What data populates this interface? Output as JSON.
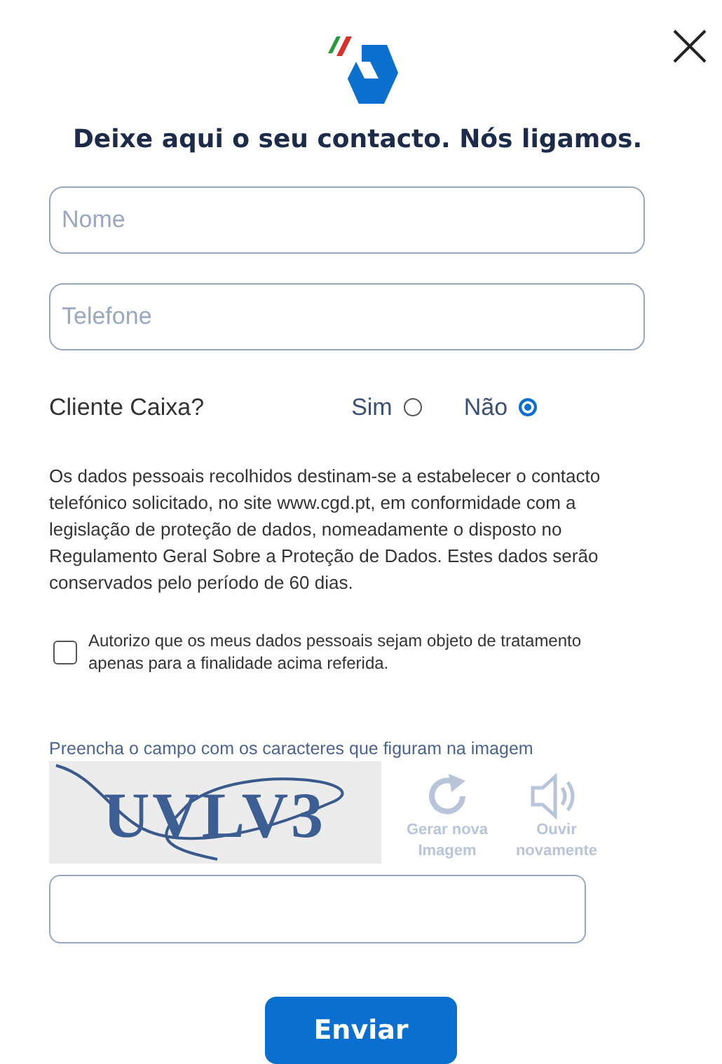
{
  "title": "Deixe aqui o seu contacto. Nós ligamos.",
  "fields": [
    {
      "placeholder": "Nome"
    },
    {
      "placeholder": "Telefone"
    }
  ],
  "client_question": {
    "label": "Cliente Caixa?",
    "options": [
      {
        "label": "Sim",
        "selected": false
      },
      {
        "label": "Não",
        "selected": true
      }
    ]
  },
  "privacy_text": "Os dados pessoais recolhidos destinam-se a estabelecer o contacto telefónico solicitado, no site www.cgd.pt, em conformidade com a legislação de proteção de dados, nomeadamente o disposto no Regulamento Geral Sobre a Proteção de Dados. Estes dados serão conservados pelo período de 60 dias.",
  "consent": {
    "label": "Autorizo que os meus dados pessoais sejam objeto de tratamento apenas para a finalidade acima referida.",
    "checked": false
  },
  "captcha": {
    "instruction": "Preencha o campo com os caracteres que figuram na imagem",
    "text": "UVLV3",
    "actions": [
      {
        "kind": "refresh",
        "label": "Gerar nova Imagem"
      },
      {
        "kind": "audio",
        "label": "Ouvir novamente"
      }
    ]
  },
  "submit": "Enviar"
}
